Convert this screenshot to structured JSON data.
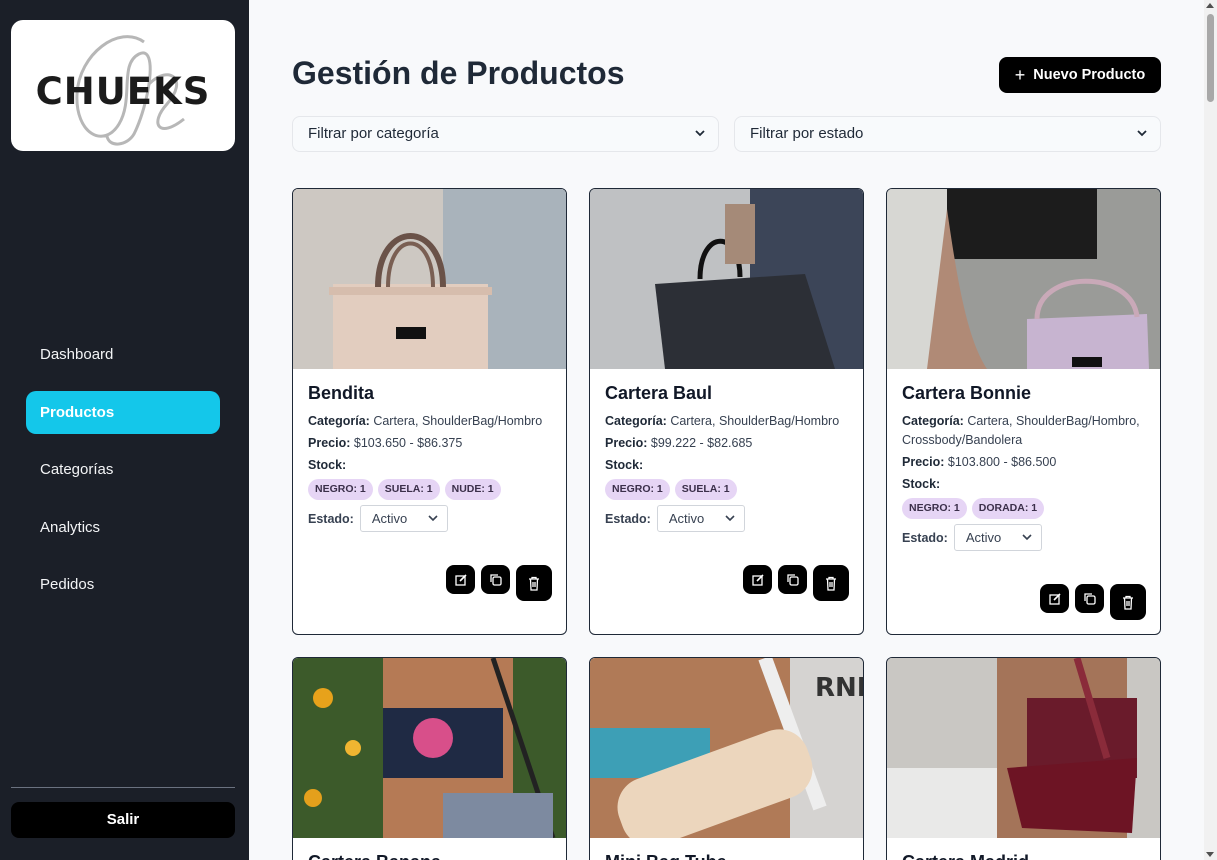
{
  "brand": {
    "logo_text": "CHUEKS"
  },
  "sidebar": {
    "items": [
      {
        "label": "Dashboard",
        "active": false
      },
      {
        "label": "Productos",
        "active": true
      },
      {
        "label": "Categorías",
        "active": false
      },
      {
        "label": "Analytics",
        "active": false
      },
      {
        "label": "Pedidos",
        "active": false
      }
    ],
    "logout_label": "Salir"
  },
  "header": {
    "title": "Gestión de Productos",
    "new_button_label": "Nuevo Producto"
  },
  "filters": {
    "category_label": "Filtrar por categoría",
    "status_label": "Filtrar por estado"
  },
  "labels": {
    "category": "Categoría:",
    "price": "Precio:",
    "stock": "Stock:",
    "status": "Estado:"
  },
  "products": [
    {
      "name": "Bendita",
      "categories": "Cartera, ShoulderBag/Hombro",
      "price": "$103.650 - $86.375",
      "stock": [
        "NEGRO: 1",
        "SUELA: 1",
        "NUDE: 1"
      ],
      "status": "Activo"
    },
    {
      "name": "Cartera Baul",
      "categories": "Cartera, ShoulderBag/Hombro",
      "price": "$99.222 - $82.685",
      "stock": [
        "NEGRO: 1",
        "SUELA: 1"
      ],
      "status": "Activo"
    },
    {
      "name": "Cartera Bonnie",
      "categories": "Cartera, ShoulderBag/Hombro, Crossbody/Bandolera",
      "price": "$103.800 - $86.500",
      "stock": [
        "NEGRO: 1",
        "DORADA: 1"
      ],
      "status": "Activo"
    },
    {
      "name": "Cartera Banana"
    },
    {
      "name": "Mini Bag Tube"
    },
    {
      "name": "Cartera Madrid"
    }
  ],
  "colors": {
    "sidebar_bg": "#1b1f28",
    "accent": "#14c7ea",
    "badge_bg": "#e6d5f5",
    "button_bg": "#000000"
  }
}
